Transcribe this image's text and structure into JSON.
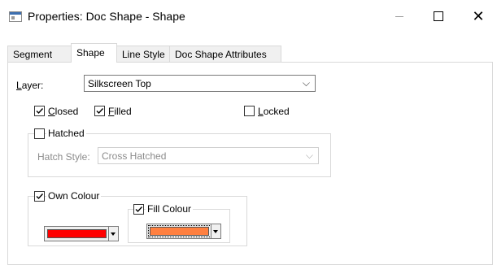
{
  "window": {
    "title": "Properties: Doc Shape - Shape",
    "controls": {
      "minimize": "minimize-icon",
      "maximize": "maximize-icon",
      "close": "close-icon"
    }
  },
  "tabs": [
    {
      "label": "Segment",
      "active": false
    },
    {
      "label": "Shape",
      "active": true
    },
    {
      "label": "Line Style",
      "active": false
    },
    {
      "label": "Doc Shape Attributes",
      "active": false
    }
  ],
  "layer": {
    "label": "Layer:",
    "value": "Silkscreen Top"
  },
  "checks": {
    "closed": {
      "label": "Closed",
      "checked": true
    },
    "filled": {
      "label": "Filled",
      "checked": true
    },
    "locked": {
      "label": "Locked",
      "checked": false
    }
  },
  "hatched": {
    "label": "Hatched",
    "checked": false,
    "style_label": "Hatch Style:",
    "style_value": "Cross Hatched"
  },
  "own_colour": {
    "label": "Own Colour",
    "checked": true,
    "color": "#ff0000",
    "fill_colour": {
      "label": "Fill Colour",
      "checked": true,
      "color": "#ff8040"
    }
  }
}
